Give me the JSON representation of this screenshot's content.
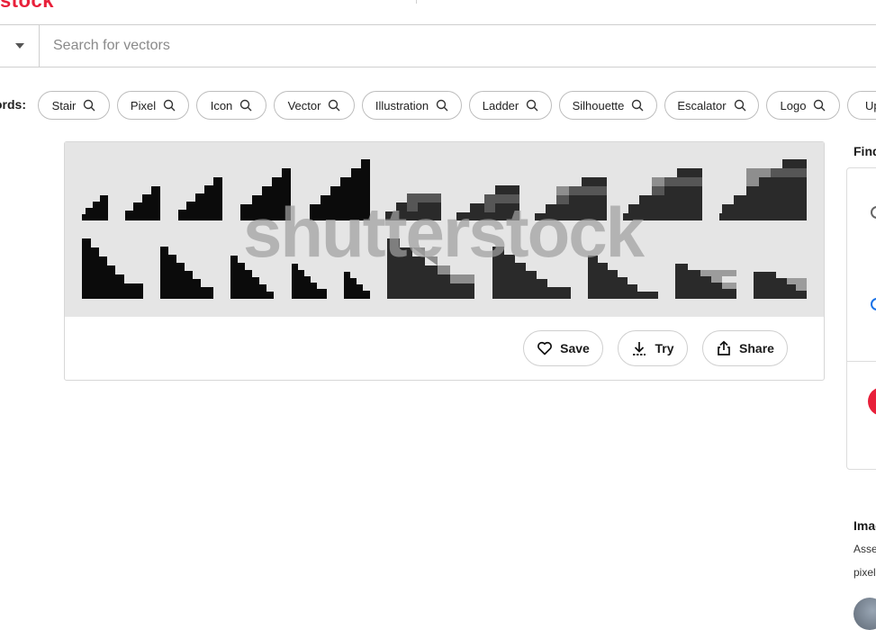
{
  "brand": {
    "logo_text": "stock"
  },
  "search": {
    "placeholder": "Search for vectors"
  },
  "keywords": {
    "label": "ords:",
    "chips": [
      "Stair",
      "Pixel",
      "Icon",
      "Vector",
      "Illustration",
      "Ladder",
      "Silhouette",
      "Escalator",
      "Logo",
      "Up"
    ]
  },
  "image_card": {
    "watermark": "shutterstock",
    "actions": {
      "save": "Save",
      "try": "Try",
      "share": "Share"
    }
  },
  "sidebar": {
    "find_title": "Find",
    "info_title": "Imag",
    "info_line1": "Asse",
    "info_line2": "pixel"
  },
  "colors": {
    "brand_red": "#e8203a",
    "border": "#cfcfcf",
    "preview_bg": "#e5e5e5",
    "radio_blue": "#1a73e8"
  },
  "icons": {
    "search": "magnifier-icon",
    "save": "heart-icon",
    "try": "download-icon",
    "share": "share-icon",
    "dropdown": "caret-down-icon"
  }
}
